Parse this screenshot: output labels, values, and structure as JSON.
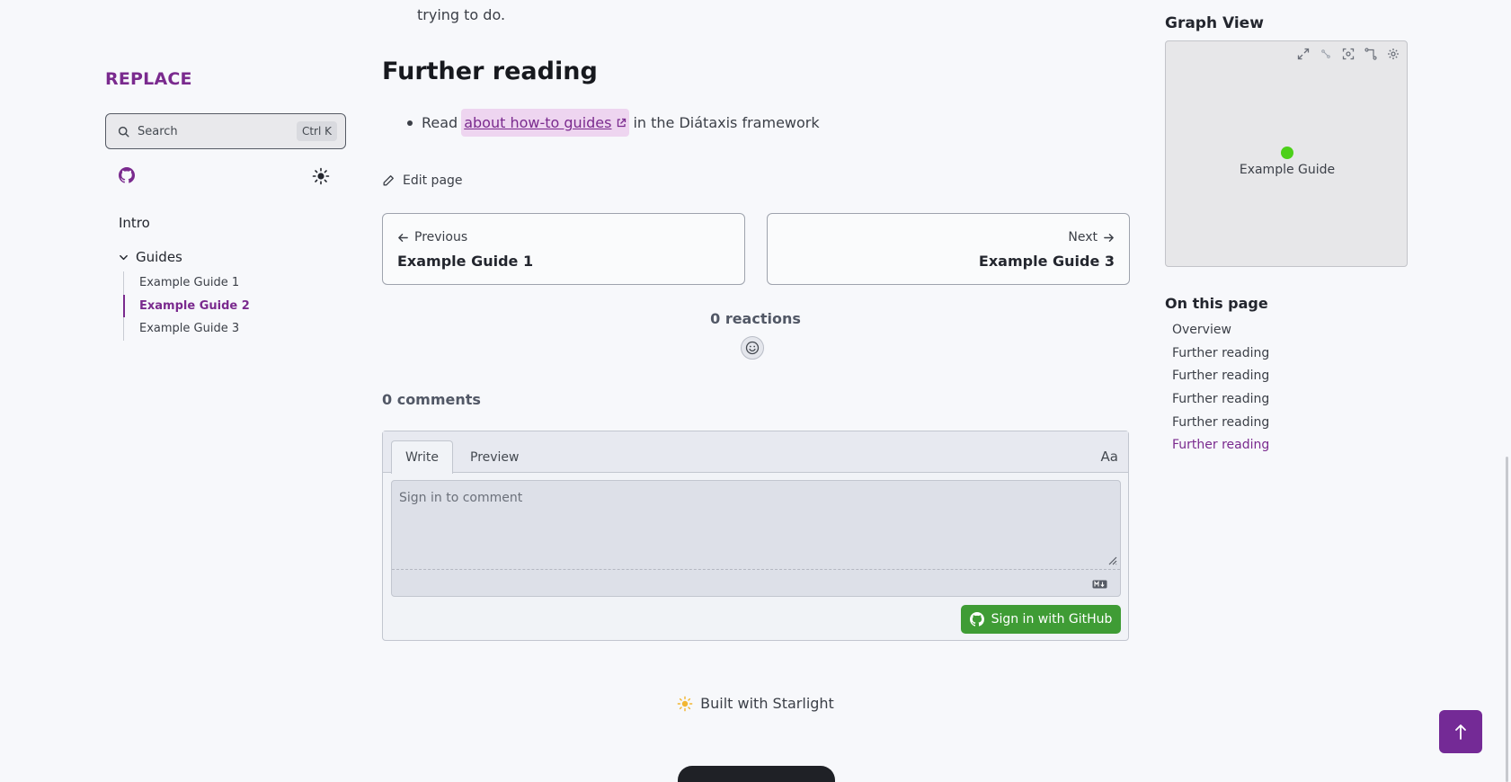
{
  "site": {
    "title": "REPLACE"
  },
  "search": {
    "label": "Search",
    "shortcut": "Ctrl K"
  },
  "sidebar": {
    "intro": "Intro",
    "group": "Guides",
    "items": [
      {
        "label": "Example Guide 1"
      },
      {
        "label": "Example Guide 2",
        "active": true
      },
      {
        "label": "Example Guide 3"
      }
    ]
  },
  "content": {
    "intro_tail": "trying to do.",
    "heading": "Further reading",
    "bullet_before": "Read",
    "bullet_link": "about how-to guides",
    "bullet_after": "in the Diátaxis framework",
    "edit_label": "Edit page"
  },
  "pagination": {
    "prev_label": "Previous",
    "prev_title": "Example Guide 1",
    "next_label": "Next",
    "next_title": "Example Guide 3"
  },
  "reactions": {
    "label": "0 reactions"
  },
  "comments": {
    "count_label": "0 comments",
    "tab_write": "Write",
    "tab_preview": "Preview",
    "format_label": "Aa",
    "placeholder": "Sign in to comment",
    "signin_label": "Sign in with GitHub"
  },
  "footer": {
    "label": "Built with Starlight"
  },
  "graph_view": {
    "title": "Graph View",
    "node_label": "Example Guide",
    "node_color": "#4cd019"
  },
  "toc": {
    "title": "On this page",
    "items": [
      {
        "label": "Overview"
      },
      {
        "label": "Further reading"
      },
      {
        "label": "Further reading"
      },
      {
        "label": "Further reading"
      },
      {
        "label": "Further reading"
      },
      {
        "label": "Further reading",
        "active": true
      }
    ]
  },
  "colors": {
    "accent": "#7a2a8e",
    "github_button": "#3f9c35",
    "to_top": "#742a96"
  }
}
